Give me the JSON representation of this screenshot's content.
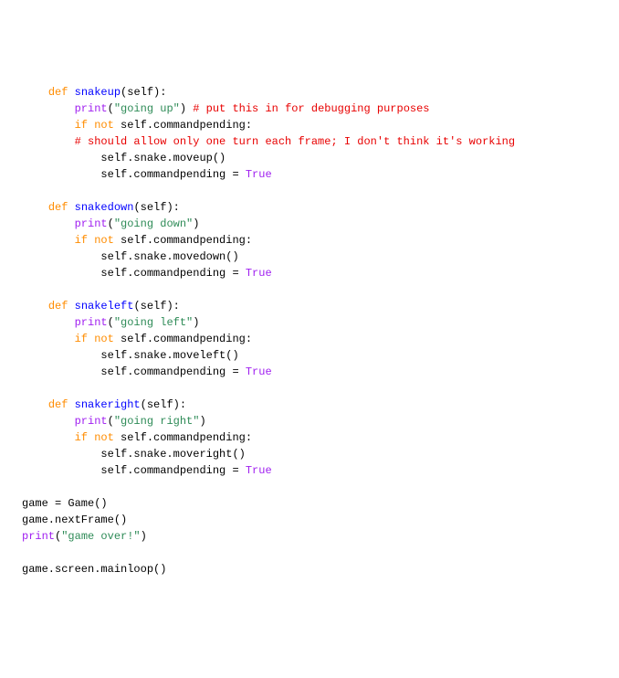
{
  "code": {
    "lines": [
      {
        "indent": "    ",
        "tokens": [
          [
            "kw",
            "def"
          ],
          [
            "plain",
            " "
          ],
          [
            "fn",
            "snakeup"
          ],
          [
            "plain",
            "(self):"
          ]
        ]
      },
      {
        "indent": "        ",
        "tokens": [
          [
            "builtin",
            "print"
          ],
          [
            "plain",
            "("
          ],
          [
            "str",
            "\"going up\""
          ],
          [
            "plain",
            ") "
          ],
          [
            "comment",
            "# put this in for debugging purposes"
          ]
        ]
      },
      {
        "indent": "        ",
        "tokens": [
          [
            "kw",
            "if"
          ],
          [
            "plain",
            " "
          ],
          [
            "kw",
            "not"
          ],
          [
            "plain",
            " self.commandpending:"
          ]
        ]
      },
      {
        "indent": "        ",
        "tokens": [
          [
            "comment",
            "# should allow only one turn each frame; I don't think it's working"
          ]
        ]
      },
      {
        "indent": "            ",
        "tokens": [
          [
            "plain",
            "self.snake.moveup()"
          ]
        ]
      },
      {
        "indent": "            ",
        "tokens": [
          [
            "plain",
            "self.commandpending = "
          ],
          [
            "builtin",
            "True"
          ]
        ]
      },
      {
        "indent": "",
        "tokens": []
      },
      {
        "indent": "    ",
        "tokens": [
          [
            "kw",
            "def"
          ],
          [
            "plain",
            " "
          ],
          [
            "fn",
            "snakedown"
          ],
          [
            "plain",
            "(self):"
          ]
        ]
      },
      {
        "indent": "        ",
        "tokens": [
          [
            "builtin",
            "print"
          ],
          [
            "plain",
            "("
          ],
          [
            "str",
            "\"going down\""
          ],
          [
            "plain",
            ")"
          ]
        ]
      },
      {
        "indent": "        ",
        "tokens": [
          [
            "kw",
            "if"
          ],
          [
            "plain",
            " "
          ],
          [
            "kw",
            "not"
          ],
          [
            "plain",
            " self.commandpending:"
          ]
        ]
      },
      {
        "indent": "            ",
        "tokens": [
          [
            "plain",
            "self.snake.movedown()"
          ]
        ]
      },
      {
        "indent": "            ",
        "tokens": [
          [
            "plain",
            "self.commandpending = "
          ],
          [
            "builtin",
            "True"
          ]
        ]
      },
      {
        "indent": "",
        "tokens": []
      },
      {
        "indent": "    ",
        "tokens": [
          [
            "kw",
            "def"
          ],
          [
            "plain",
            " "
          ],
          [
            "fn",
            "snakeleft"
          ],
          [
            "plain",
            "(self):"
          ]
        ]
      },
      {
        "indent": "        ",
        "tokens": [
          [
            "builtin",
            "print"
          ],
          [
            "plain",
            "("
          ],
          [
            "str",
            "\"going left\""
          ],
          [
            "plain",
            ")"
          ]
        ]
      },
      {
        "indent": "        ",
        "tokens": [
          [
            "kw",
            "if"
          ],
          [
            "plain",
            " "
          ],
          [
            "kw",
            "not"
          ],
          [
            "plain",
            " self.commandpending:"
          ]
        ]
      },
      {
        "indent": "            ",
        "tokens": [
          [
            "plain",
            "self.snake.moveleft()"
          ]
        ]
      },
      {
        "indent": "            ",
        "tokens": [
          [
            "plain",
            "self.commandpending = "
          ],
          [
            "builtin",
            "True"
          ]
        ]
      },
      {
        "indent": "",
        "tokens": []
      },
      {
        "indent": "    ",
        "tokens": [
          [
            "kw",
            "def"
          ],
          [
            "plain",
            " "
          ],
          [
            "fn",
            "snakeright"
          ],
          [
            "plain",
            "(self):"
          ]
        ]
      },
      {
        "indent": "        ",
        "tokens": [
          [
            "builtin",
            "print"
          ],
          [
            "plain",
            "("
          ],
          [
            "str",
            "\"going right\""
          ],
          [
            "plain",
            ")"
          ]
        ]
      },
      {
        "indent": "        ",
        "tokens": [
          [
            "kw",
            "if"
          ],
          [
            "plain",
            " "
          ],
          [
            "kw",
            "not"
          ],
          [
            "plain",
            " self.commandpending:"
          ]
        ]
      },
      {
        "indent": "            ",
        "tokens": [
          [
            "plain",
            "self.snake.moveright()"
          ]
        ]
      },
      {
        "indent": "            ",
        "tokens": [
          [
            "plain",
            "self.commandpending = "
          ],
          [
            "builtin",
            "True"
          ]
        ]
      },
      {
        "indent": "",
        "tokens": []
      },
      {
        "indent": "",
        "tokens": [
          [
            "plain",
            "game = Game()"
          ]
        ]
      },
      {
        "indent": "",
        "tokens": [
          [
            "plain",
            "game.nextFrame()"
          ]
        ]
      },
      {
        "indent": "",
        "tokens": [
          [
            "builtin",
            "print"
          ],
          [
            "plain",
            "("
          ],
          [
            "str",
            "\"game over!\""
          ],
          [
            "plain",
            ")"
          ]
        ]
      },
      {
        "indent": "",
        "tokens": []
      },
      {
        "indent": "",
        "tokens": [
          [
            "plain",
            "game.screen.mainloop()"
          ]
        ]
      }
    ]
  }
}
